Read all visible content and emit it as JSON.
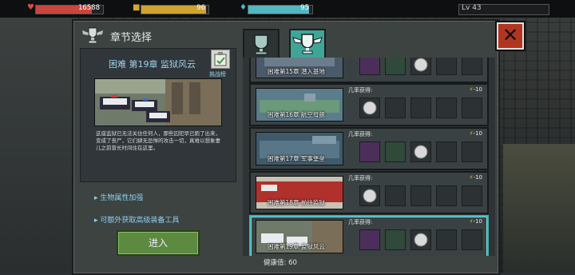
{
  "hud": {
    "health_value": "16588",
    "food_value": "96",
    "water_value": "95",
    "level_label": "Lv 43",
    "health_fill": 0.83,
    "food_fill": 0.96,
    "water_fill": 0.95,
    "colors": {
      "health": "#c9463c",
      "food": "#cfa232",
      "water": "#55b6c2"
    }
  },
  "panel": {
    "title": "章节选择"
  },
  "selected_chapter": {
    "title": "困难 第19章 监狱风云",
    "challenge_label": "挑战榜",
    "description": "这座监狱已无法关住任何人，那些囚犯早已跑了出来，变成了丧尸，它们肆无忌惮的攻击一切，真难以想象妻儿之前曾长时间住在这里。",
    "bullets": [
      "生物属性加强",
      "可额外获取高级装备工具"
    ],
    "enter_label": "进入"
  },
  "chapters": [
    {
      "name": "困难第15章 潜入基地",
      "drop_label": "",
      "cost": "",
      "theme": "lab"
    },
    {
      "name": "困难第16章 航空母舰",
      "drop_label": "几率获得:",
      "cost": "-10",
      "theme": "ship"
    },
    {
      "name": "困难第17章 军事堡垒",
      "drop_label": "几率获得:",
      "cost": "-10",
      "theme": "fort"
    },
    {
      "name": "困难第18章 前往监狱",
      "drop_label": "几率获得:",
      "cost": "-10",
      "theme": "train"
    },
    {
      "name": "困难第19章 监狱风云",
      "drop_label": "几率获得:",
      "cost": "-10",
      "theme": "prison"
    }
  ],
  "footer": {
    "health_label": "健康值: 60"
  }
}
